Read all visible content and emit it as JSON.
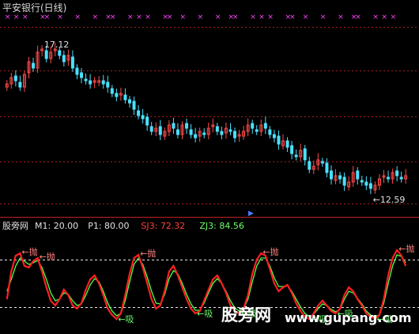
{
  "chart_data": [
    {
      "type": "candlestick",
      "title": "平安银行(日线)",
      "price_range": [
        12.0,
        18.0
      ],
      "annotations": {
        "high_label": "17.12",
        "low_label": "←12.59"
      },
      "colors": {
        "up": "#ff4a4a",
        "down": "#4ae0ff",
        "marker": "#ff44ff"
      },
      "grid": true,
      "closes": [
        15.9,
        16.1,
        16.0,
        15.8,
        16.2,
        16.6,
        16.4,
        16.9,
        17.0,
        16.7,
        16.9,
        17.0,
        16.8,
        16.6,
        16.8,
        16.4,
        16.2,
        16.1,
        16.0,
        15.9,
        16.0,
        16.0,
        15.9,
        15.8,
        15.6,
        15.5,
        15.6,
        15.4,
        15.3,
        15.1,
        14.9,
        14.8,
        14.6,
        14.4,
        14.5,
        14.3,
        14.4,
        14.6,
        14.5,
        14.3,
        14.6,
        14.5,
        14.3,
        14.2,
        14.4,
        14.3,
        14.5,
        14.6,
        14.4,
        14.3,
        14.5,
        14.4,
        14.2,
        14.3,
        14.4,
        14.6,
        14.5,
        14.4,
        14.6,
        14.5,
        14.3,
        14.2,
        14.0,
        14.1,
        13.9,
        13.7,
        13.6,
        13.8,
        13.5,
        13.2,
        13.3,
        13.5,
        13.4,
        13.1,
        12.9,
        13.0,
        12.9,
        12.7,
        12.8,
        13.1,
        12.9,
        12.8,
        12.7,
        12.6,
        12.7,
        12.9,
        13.0,
        12.9,
        13.1,
        13.0,
        12.9,
        13.0
      ]
    },
    {
      "type": "line",
      "indicator_name": "股旁网",
      "params": [
        {
          "label": "M1: 20.00",
          "color": "#e0e0e0"
        },
        {
          "label": "P1: 80.00",
          "color": "#e0e0e0"
        },
        {
          "label": "SJ3: 72.32",
          "color": "#ff4040"
        },
        {
          "label": "ZJ3: 84.56",
          "color": "#6cff6c"
        }
      ],
      "ylim": [
        -10,
        110
      ],
      "levels": [
        20,
        80
      ],
      "series": [
        {
          "name": "SJ3",
          "color": "#ff2020",
          "values": [
            30,
            65,
            85,
            88,
            72,
            70,
            78,
            82,
            65,
            45,
            28,
            22,
            30,
            42,
            35,
            22,
            18,
            25,
            42,
            55,
            60,
            50,
            35,
            18,
            10,
            5,
            12,
            35,
            62,
            82,
            86,
            70,
            50,
            30,
            18,
            22,
            40,
            65,
            72,
            60,
            45,
            30,
            18,
            12,
            15,
            28,
            42,
            55,
            60,
            50,
            38,
            22,
            15,
            12,
            18,
            35,
            62,
            80,
            88,
            85,
            68,
            50,
            40,
            45,
            48,
            38,
            25,
            15,
            8,
            5,
            12,
            22,
            28,
            22,
            15,
            12,
            18,
            35,
            45,
            40,
            30,
            22,
            12,
            8,
            5,
            10,
            30,
            60,
            82,
            92,
            85,
            72
          ]
        },
        {
          "name": "ZJ3",
          "color": "#4cff4c",
          "values": [
            40,
            55,
            72,
            82,
            78,
            74,
            76,
            79,
            70,
            55,
            38,
            28,
            30,
            38,
            36,
            28,
            22,
            24,
            35,
            48,
            56,
            52,
            40,
            25,
            15,
            9,
            12,
            28,
            52,
            74,
            82,
            74,
            58,
            40,
            25,
            24,
            36,
            56,
            66,
            62,
            50,
            36,
            24,
            16,
            16,
            25,
            38,
            50,
            56,
            50,
            40,
            28,
            19,
            15,
            18,
            30,
            52,
            72,
            82,
            82,
            72,
            57,
            46,
            46,
            47,
            40,
            30,
            20,
            12,
            8,
            11,
            18,
            24,
            22,
            17,
            14,
            17,
            30,
            40,
            38,
            31,
            24,
            15,
            10,
            8,
            10,
            25,
            50,
            72,
            86,
            84,
            76
          ]
        }
      ],
      "annotations": {
        "throw_label": "←抛",
        "suck_label": "←吸"
      }
    }
  ],
  "watermark": {
    "main": "股旁网",
    "url": "www.gupang.com"
  }
}
